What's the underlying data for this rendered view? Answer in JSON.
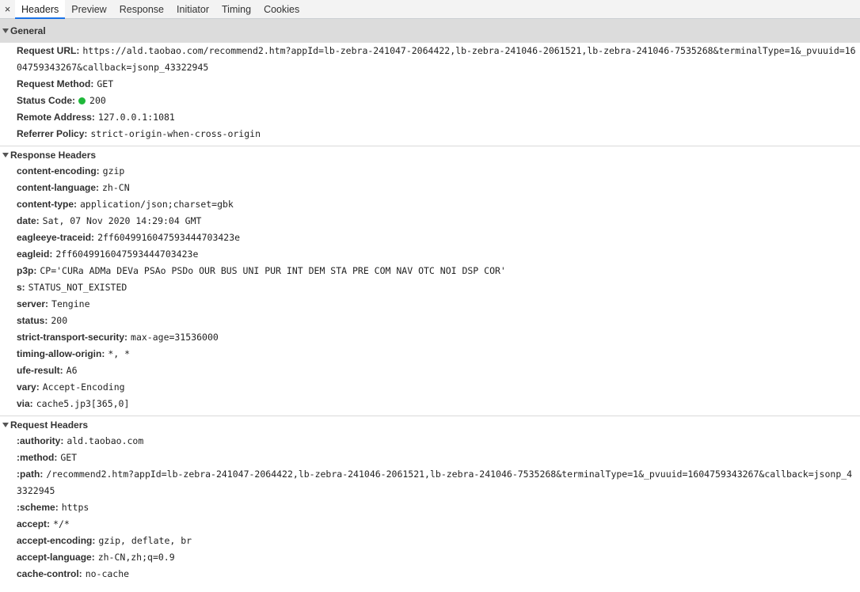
{
  "tabs": {
    "close": "×",
    "items": [
      "Headers",
      "Preview",
      "Response",
      "Initiator",
      "Timing",
      "Cookies"
    ],
    "active": "Headers"
  },
  "general": {
    "title": "General",
    "request_url_key": "Request URL:",
    "request_url_value": "https://ald.taobao.com/recommend2.htm?appId=lb-zebra-241047-2064422,lb-zebra-241046-2061521,lb-zebra-241046-7535268&terminalType=1&_pvuuid=1604759343267&callback=jsonp_43322945",
    "request_method_key": "Request Method:",
    "request_method_value": "GET",
    "status_code_key": "Status Code:",
    "status_code_value": "200",
    "status_color": "#1fb83a",
    "remote_address_key": "Remote Address:",
    "remote_address_value": "127.0.0.1:1081",
    "referrer_policy_key": "Referrer Policy:",
    "referrer_policy_value": "strict-origin-when-cross-origin"
  },
  "response_headers": {
    "title": "Response Headers",
    "items": [
      {
        "k": "content-encoding:",
        "v": "gzip"
      },
      {
        "k": "content-language:",
        "v": "zh-CN"
      },
      {
        "k": "content-type:",
        "v": "application/json;charset=gbk"
      },
      {
        "k": "date:",
        "v": "Sat, 07 Nov 2020 14:29:04 GMT"
      },
      {
        "k": "eagleeye-traceid:",
        "v": "2ff604991604759344470342​3e"
      },
      {
        "k": "eagleid:",
        "v": "2ff6049916047593444703423e"
      },
      {
        "k": "p3p:",
        "v": "CP='CURa ADMa DEVa PSAo PSDo OUR BUS UNI PUR INT DEM STA PRE COM NAV OTC NOI DSP COR'"
      },
      {
        "k": "s:",
        "v": "STATUS_NOT_EXISTED"
      },
      {
        "k": "server:",
        "v": "Tengine"
      },
      {
        "k": "status:",
        "v": "200"
      },
      {
        "k": "strict-transport-security:",
        "v": "max-age=31536000"
      },
      {
        "k": "timing-allow-origin:",
        "v": "*, *"
      },
      {
        "k": "ufe-result:",
        "v": "A6"
      },
      {
        "k": "vary:",
        "v": "Accept-Encoding"
      },
      {
        "k": "via:",
        "v": "cache5.jp3[365,0]"
      }
    ]
  },
  "request_headers": {
    "title": "Request Headers",
    "items": [
      {
        "k": ":authority:",
        "v": "ald.taobao.com"
      },
      {
        "k": ":method:",
        "v": "GET"
      },
      {
        "k": ":path:",
        "v": "/recommend2.htm?appId=lb-zebra-241047-2064422,lb-zebra-241046-2061521,lb-zebra-241046-7535268&terminalType=1&_pvuuid=1604759343267&callback=jsonp_43322945",
        "wrap": true
      },
      {
        "k": ":scheme:",
        "v": "https"
      },
      {
        "k": "accept:",
        "v": "*/*"
      },
      {
        "k": "accept-encoding:",
        "v": "gzip, deflate, br"
      },
      {
        "k": "accept-language:",
        "v": "zh-CN,zh;q=0.9"
      },
      {
        "k": "cache-control:",
        "v": "no-cache"
      }
    ]
  }
}
